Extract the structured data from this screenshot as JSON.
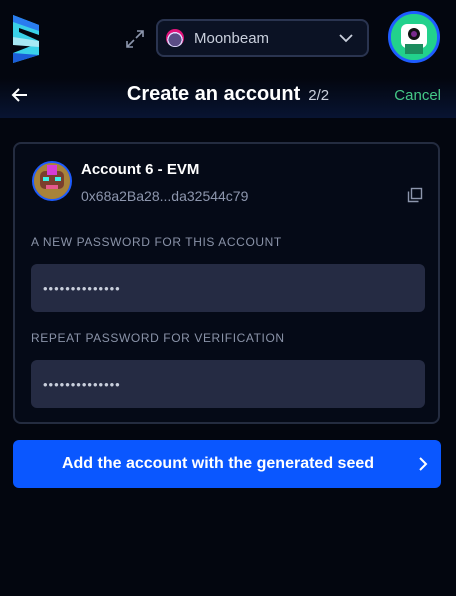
{
  "header": {
    "network": {
      "label": "Moonbeam",
      "icon": "moonbeam-icon"
    },
    "logo": "subwallet-logo",
    "expand_icon": "expand-icon",
    "avatar_icon": "account-avatar"
  },
  "titlebar": {
    "back_icon": "arrow-left-icon",
    "title": "Create an account",
    "step": "2/2",
    "cancel_label": "Cancel"
  },
  "account": {
    "name": "Account 6 - EVM",
    "address": "0x68a2Ba28...da32544c79",
    "copy_icon": "copy-icon"
  },
  "form": {
    "password_label": "A NEW PASSWORD FOR THIS ACCOUNT",
    "password_value": "••••••••••••••",
    "repeat_label": "REPEAT PASSWORD FOR VERIFICATION",
    "repeat_value": "••••••••••••••"
  },
  "submit": {
    "label": "Add the account with the generated seed",
    "icon": "chevron-right-icon"
  },
  "colors": {
    "background": "#03060f",
    "accent": "#0a57ff",
    "cancel": "#45c987",
    "field": "#252b43"
  }
}
